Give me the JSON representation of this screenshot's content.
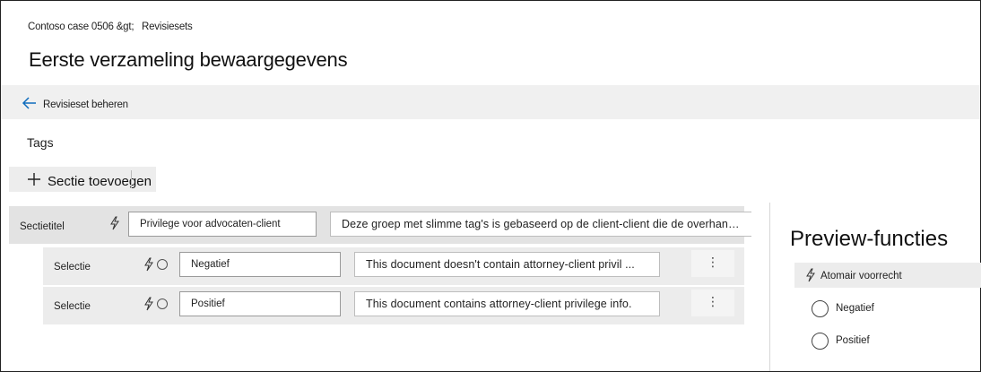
{
  "breadcrumb": {
    "case": "Contoso case 0506 &gt;",
    "current": "Revisiesets"
  },
  "page": {
    "title": "Eerste verzameling bewaargegevens"
  },
  "commandbar": {
    "back_label": "Revisieset beheren"
  },
  "tags_heading": "Tags",
  "add_section_label": "Sectie toevoegen",
  "section": {
    "label": "Sectietitel",
    "name_value": "Privilege voor advocaten-client",
    "description_value": "Deze groep met slimme tag's is gebaseerd op de client-client die de overhand heeft..."
  },
  "choices": [
    {
      "label": "Selectie",
      "name_value": "Negatief",
      "description_value": "This document doesn't contain attorney-client privil ..."
    },
    {
      "label": "Selectie",
      "name_value": "Positief",
      "description_value": "This document contains attorney-client privilege info."
    }
  ],
  "more_glyph": "⋮",
  "preview": {
    "title": "Preview-functies",
    "group_label": "Atomair voorrecht",
    "options": [
      "Negatief",
      "Positief"
    ]
  },
  "colors": {
    "accent": "#0f6cbd",
    "command_bar_bg": "#f0f0f0",
    "section_row_bg": "#e3e3e3",
    "choice_row_bg": "#ececec"
  },
  "icons": {
    "back": "arrow-left-icon",
    "add": "plus-icon",
    "smart_tag": "lightning-bolt-icon",
    "radio": "radio-circle-icon",
    "more": "more-vertical-icon"
  }
}
